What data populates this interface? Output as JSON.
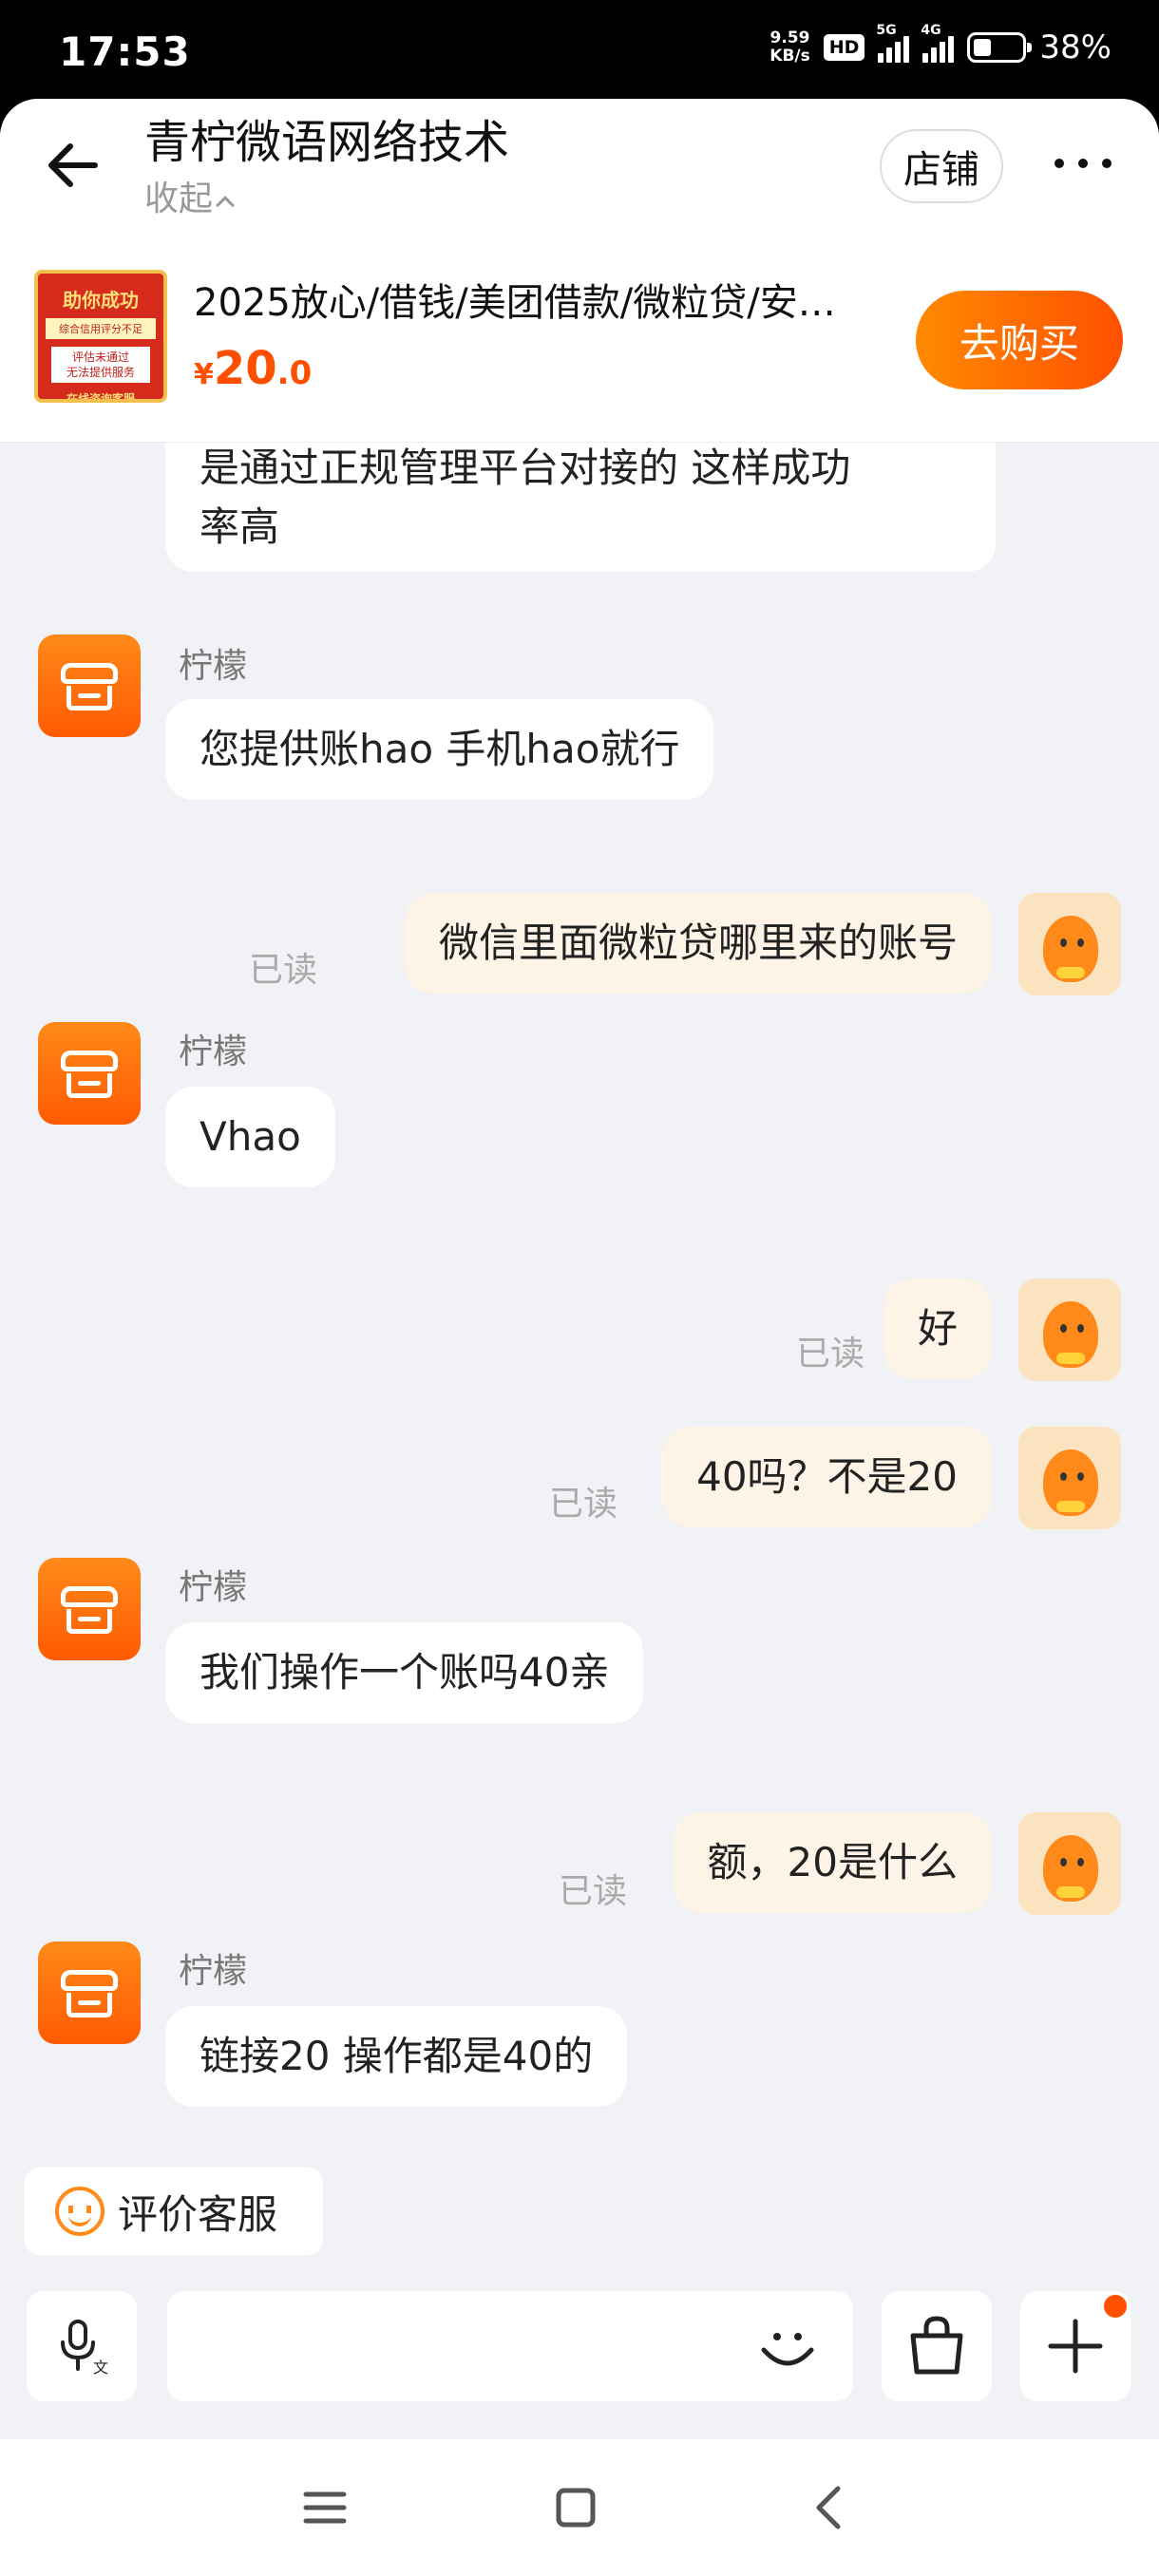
{
  "status_bar": {
    "time": "17:53",
    "net_speed_value": "9.59",
    "net_speed_unit": "KB/s",
    "hd_badge": "HD",
    "signal1_label": "5G",
    "signal2_label": "4G",
    "battery_percent": "38%"
  },
  "header": {
    "shop_name": "青柠微语网络技术",
    "collapse_label": "收起",
    "store_button": "店铺",
    "more_icon": "more-dots-icon"
  },
  "product": {
    "thumb_line1": "助你成功",
    "thumb_line2": "综合信用评分不足",
    "thumb_line3": "评估未通过\n无法提供服务",
    "thumb_line4": "在线咨询客服",
    "title": "2025放心/借钱/美团借款/微粒贷/安…",
    "price_currency": "¥",
    "price_int": "20",
    "price_dec": ".0",
    "buy_button": "去购买"
  },
  "messages": [
    {
      "side": "in",
      "text_line1": "是通过正规管理平台对接的  这样成功",
      "text_line2": "率高"
    },
    {
      "side": "in",
      "sender": "柠檬",
      "text": "您提供账hao  手机hao就行"
    },
    {
      "side": "out",
      "read": "已读",
      "text": "微信里面微粒贷哪里来的账号"
    },
    {
      "side": "in",
      "sender": "柠檬",
      "text": "Vhao"
    },
    {
      "side": "out",
      "read": "已读",
      "text": "好"
    },
    {
      "side": "out",
      "read": "已读",
      "text": "40吗？不是20"
    },
    {
      "side": "in",
      "sender": "柠檬",
      "text": "我们操作一个账吗40亲"
    },
    {
      "side": "out",
      "read": "已读",
      "text": "额，20是什么"
    },
    {
      "side": "in",
      "sender": "柠檬",
      "text": "链接20 操作都是40的"
    }
  ],
  "rate_button": "评价客服",
  "input_bar": {
    "placeholder": "",
    "voice_icon": "voice-input-icon",
    "emoji_icon": "emoji-icon",
    "bag_icon": "shopping-bag-icon",
    "plus_icon": "plus-icon"
  },
  "nav_bar": {
    "menu_icon": "menu-icon",
    "home_icon": "home-square-icon",
    "back_icon": "back-triangle-icon"
  },
  "colors": {
    "accent": "#ff5000",
    "accent_light": "#ff8a00",
    "chat_bg": "#f0f2f5",
    "out_bubble": "#fdf3e7"
  }
}
